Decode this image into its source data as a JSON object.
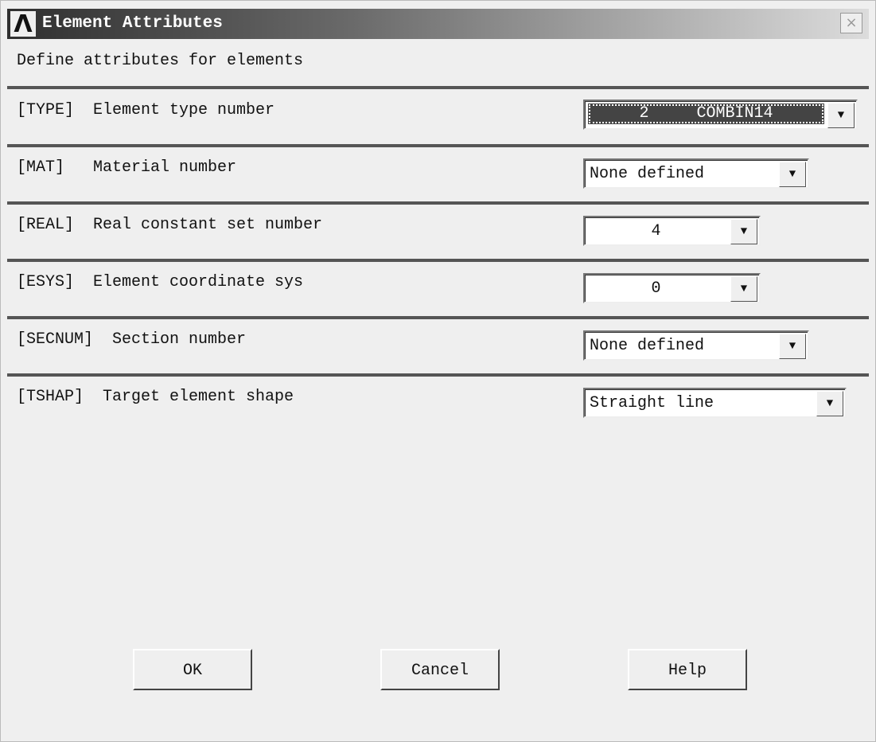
{
  "window": {
    "title": "Element Attributes",
    "logo": "ansys-logo",
    "close_icon": "close-icon"
  },
  "subtitle": "Define attributes for elements",
  "fields": [
    {
      "label": "[TYPE]  Element type number",
      "value": "2     COMBIN14"
    },
    {
      "label": "[MAT]   Material number",
      "value": "None defined"
    },
    {
      "label": "[REAL]  Real constant set number",
      "value": "4"
    },
    {
      "label": "[ESYS]  Element coordinate sys",
      "value": "0"
    },
    {
      "label": "[SECNUM]  Section number",
      "value": "None defined"
    },
    {
      "label": "[TSHAP]  Target element shape",
      "value": "Straight line"
    }
  ],
  "buttons": {
    "ok": "OK",
    "cancel": "Cancel",
    "help": "Help"
  }
}
